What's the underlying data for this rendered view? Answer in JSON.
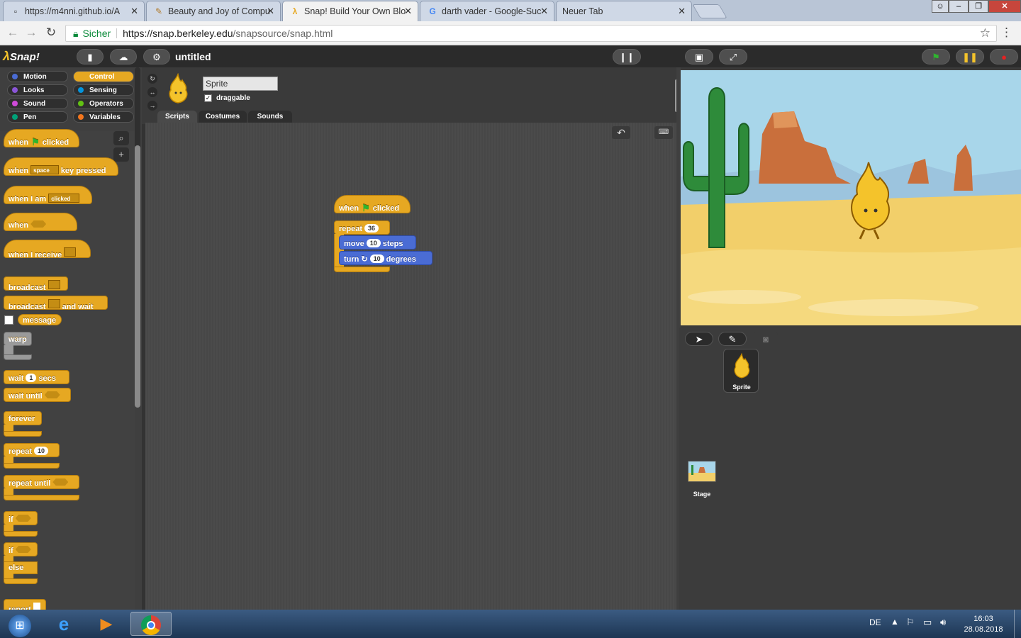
{
  "browser": {
    "tabs": [
      {
        "label": "https://m4nni.github.io/A",
        "icon": "document-icon"
      },
      {
        "label": "Beauty and Joy of Compu",
        "icon": "bjc-icon"
      },
      {
        "label": "Snap! Build Your Own Blo",
        "icon": "snap-lambda-icon"
      },
      {
        "label": "darth vader - Google-Suc",
        "icon": "google-icon"
      },
      {
        "label": "Neuer Tab",
        "icon": ""
      }
    ],
    "secure_label": "Sicher",
    "url_host": "https://snap.berkeley.edu",
    "url_path": "/snapsource/snap.html"
  },
  "snap": {
    "logo": "Snap!",
    "project_name": "untitled",
    "categories": [
      {
        "label": "Motion",
        "color": "#4a6cd4"
      },
      {
        "label": "Control",
        "color": "#e6a822"
      },
      {
        "label": "Looks",
        "color": "#8a55d7"
      },
      {
        "label": "Sensing",
        "color": "#0494dc"
      },
      {
        "label": "Sound",
        "color": "#cf4ad9"
      },
      {
        "label": "Operators",
        "color": "#62c213"
      },
      {
        "label": "Pen",
        "color": "#00a178"
      },
      {
        "label": "Variables",
        "color": "#f3761d"
      }
    ],
    "palette": {
      "when": "when",
      "clicked": "clicked",
      "space": "space",
      "key_pressed": "key pressed",
      "when_i_am": "when I am",
      "clicked_dd": "clicked",
      "when_i_receive": "when I receive",
      "broadcast": "broadcast",
      "and_wait": "and wait",
      "message": "message",
      "warp": "warp",
      "wait": "wait",
      "wait_secs_value": "1",
      "secs": "secs",
      "wait_until": "wait until",
      "forever": "forever",
      "repeat": "repeat",
      "repeat_value": "10",
      "repeat_until": "repeat until",
      "if": "if",
      "else": "else",
      "report": "report"
    },
    "sprite": {
      "name": "Sprite",
      "draggable_label": "draggable",
      "draggable_checked": "✓"
    },
    "editor_tabs": [
      "Scripts",
      "Costumes",
      "Sounds"
    ],
    "script": {
      "when": "when",
      "clicked": "clicked",
      "repeat": "repeat",
      "repeat_value": "36",
      "move": "move",
      "move_value": "10",
      "steps": "steps",
      "turn": "turn",
      "turn_value": "10",
      "degrees": "degrees"
    },
    "corral": {
      "sprite_label": "Sprite",
      "stage_label": "Stage"
    }
  },
  "taskbar": {
    "lang": "DE",
    "time": "16:03",
    "date": "28.08.2018"
  }
}
